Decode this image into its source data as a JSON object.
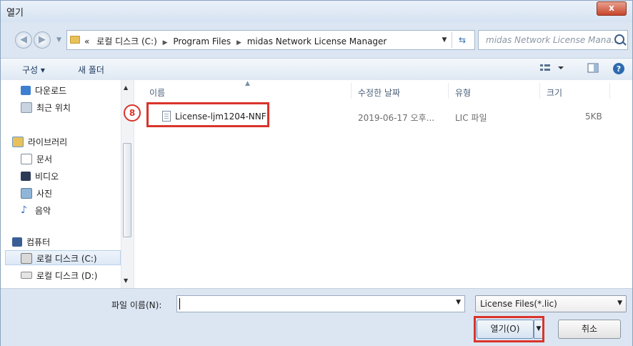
{
  "window": {
    "title": "열기",
    "close_label": "x"
  },
  "address_bar": {
    "overflow": "«",
    "crumbs": [
      "로컬 디스크 (C:)",
      "Program Files",
      "midas Network License Manager"
    ],
    "search_placeholder": "midas Network License Mana..."
  },
  "toolbar": {
    "organize": "구성 ▾",
    "new_folder": "새 폴더"
  },
  "nav": {
    "items": [
      "다운로드",
      "최근 위치",
      "라이브러리",
      "문서",
      "비디오",
      "사진",
      "음악",
      "컴퓨터",
      "로컬 디스크 (C:)",
      "로컬 디스크 (D:)"
    ],
    "selected": "로컬 디스크 (C:)"
  },
  "columns": {
    "name": "이름",
    "modified": "수정한 날짜",
    "type": "유형",
    "size": "크기"
  },
  "files": [
    {
      "name": "License-ljm1204-NNF",
      "modified": "2019-06-17 오후...",
      "type": "LIC 파일",
      "size": "5KB"
    }
  ],
  "callout": {
    "step": "8"
  },
  "footer": {
    "filename_label": "파일 이름(N):",
    "filename_value": "",
    "filter": "License Files(*.lic)",
    "open": "열기(O)",
    "cancel": "취소"
  },
  "colors": {
    "highlight": "#d9342b",
    "window_bg": "#dce6f2"
  }
}
